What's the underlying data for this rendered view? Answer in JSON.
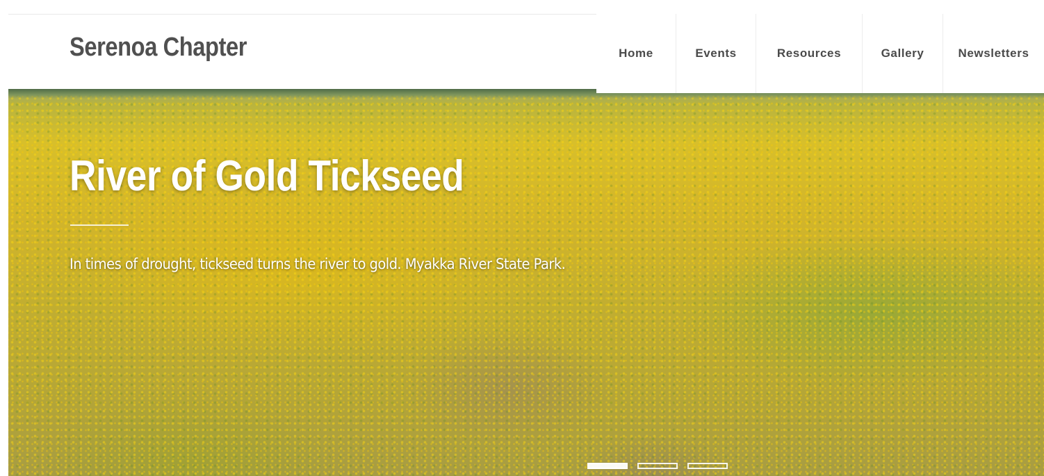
{
  "header": {
    "site_title": "Serenoa Chapter",
    "nav": [
      {
        "label": "Home"
      },
      {
        "label": "Events"
      },
      {
        "label": "Resources"
      },
      {
        "label": "Gallery"
      },
      {
        "label": "Newsletters"
      }
    ]
  },
  "hero": {
    "title": "River of Gold Tickseed",
    "caption": "In times of drought, tickseed turns the river to gold. Myakka River State Park.",
    "slides": [
      {
        "active": true
      },
      {
        "active": false
      },
      {
        "active": false
      }
    ]
  },
  "colors": {
    "title_gray": "#505050",
    "nav_text": "#4a4a4a",
    "hero_gold": "#d3b52a",
    "white": "#ffffff"
  }
}
